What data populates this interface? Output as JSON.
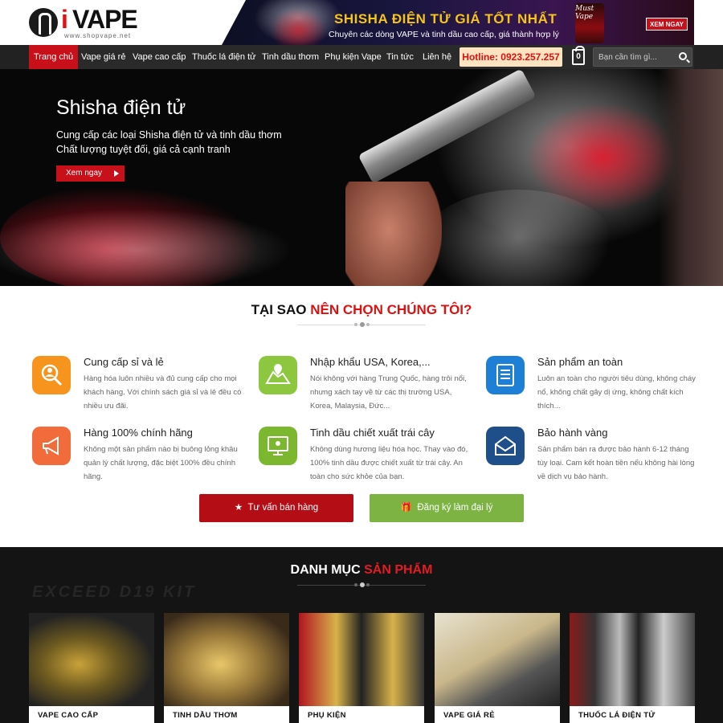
{
  "header": {
    "logo": {
      "brand_i": "i",
      "brand_vape": "VAPE",
      "url": "www.shopvape.net"
    },
    "banner": {
      "title": "SHISHA ĐIỆN TỬ GIÁ TỐT NHẤT",
      "subtitle": "Chuyên các dòng VAPE và tinh dầu cao cấp, giá thành hợp lý",
      "bottle_label": "Must Vape",
      "button": "XEM NGAY"
    }
  },
  "nav": {
    "items": [
      {
        "label": "Trang chủ",
        "active": true
      },
      {
        "label": "Vape giá rẻ",
        "active": false
      },
      {
        "label": "Vape cao cấp",
        "active": false
      },
      {
        "label": "Thuốc lá điện tử",
        "active": false
      },
      {
        "label": "Tinh dầu thơm",
        "active": false
      },
      {
        "label": "Phụ kiện Vape",
        "active": false
      },
      {
        "label": "Tin tức",
        "active": false
      },
      {
        "label": "Liên hệ",
        "active": false
      }
    ],
    "hotline": "Hotline: 0923.257.257",
    "cart_count": "0",
    "search_placeholder": "Bạn cần tìm gì..."
  },
  "hero": {
    "title": "Shisha điện tử",
    "line1": "Cung cấp các loại Shisha điện tử và tinh dầu thơm",
    "line2": "Chất lượng tuyệt đối, giá cả cạnh tranh",
    "button": "Xem ngay"
  },
  "why": {
    "title_black": "TẠI SAO ",
    "title_red": "NÊN CHỌN CHÚNG TÔI?",
    "features": [
      {
        "title": "Cung cấp sỉ và lẻ",
        "desc": "Hàng hóa luôn nhiều và đủ cung cấp cho mọi khách hàng. Với chính sách giá sỉ và lẻ đều có nhiều ưu đãi.",
        "icon": "search-user-icon",
        "color": "#f7941d"
      },
      {
        "title": "Nhập khẩu USA, Korea,...",
        "desc": "Nói không với hàng Trung Quốc, hàng trôi nổi, nhưng xách tay về từ các thị trường USA, Korea, Malaysia, Đức...",
        "icon": "map-pin-icon",
        "color": "#8dc63f"
      },
      {
        "title": "Sản phẩm an toàn",
        "desc": "Luôn an toàn cho người tiêu dùng, không cháy nổ, không chất gây dị ứng, không chất kích thích...",
        "icon": "document-icon",
        "color": "#1e7fd6"
      },
      {
        "title": "Hàng 100% chính hãng",
        "desc": "Không một sản phẩm nào bị buông lỏng khâu quản lý chất lượng, đặc biệt 100% đều chính hãng.",
        "icon": "megaphone-icon",
        "color": "#f26b3a"
      },
      {
        "title": "Tinh dầu chiết xuất trái cây",
        "desc": "Không dùng hương liệu hóa học. Thay vào đó, 100% tinh dầu được chiết xuất từ trái cây. An toàn cho sức khỏe của bạn.",
        "icon": "monitor-icon",
        "color": "#7cb82f"
      },
      {
        "title": "Bảo hành vàng",
        "desc": "Sản phẩm bán ra được bảo hành 6-12 tháng tùy loại. Cam kết hoàn tiền nếu không hài lòng về dịch vụ bảo hành.",
        "icon": "mail-icon",
        "color": "#1f4f8b"
      }
    ],
    "cta_consult": "Tư vấn bán hàng",
    "cta_agent": "Đăng ký làm đại lý"
  },
  "categories": {
    "watermark": "EXCEED D19 KIT",
    "title_white": "DANH MỤC ",
    "title_red": "SẢN PHẨM",
    "items": [
      {
        "label": "VAPE CAO CẤP"
      },
      {
        "label": "TINH DẦU THƠM"
      },
      {
        "label": "PHỤ KIỆN"
      },
      {
        "label": "VAPE GIÁ RẺ"
      },
      {
        "label": "THUỐC LÁ ĐIỆN TỬ"
      }
    ]
  },
  "colors": {
    "accent_red": "#c8101a",
    "cta_green": "#7cb342",
    "hotline_bg": "#fde3c0",
    "banner_title": "#f5c518"
  }
}
